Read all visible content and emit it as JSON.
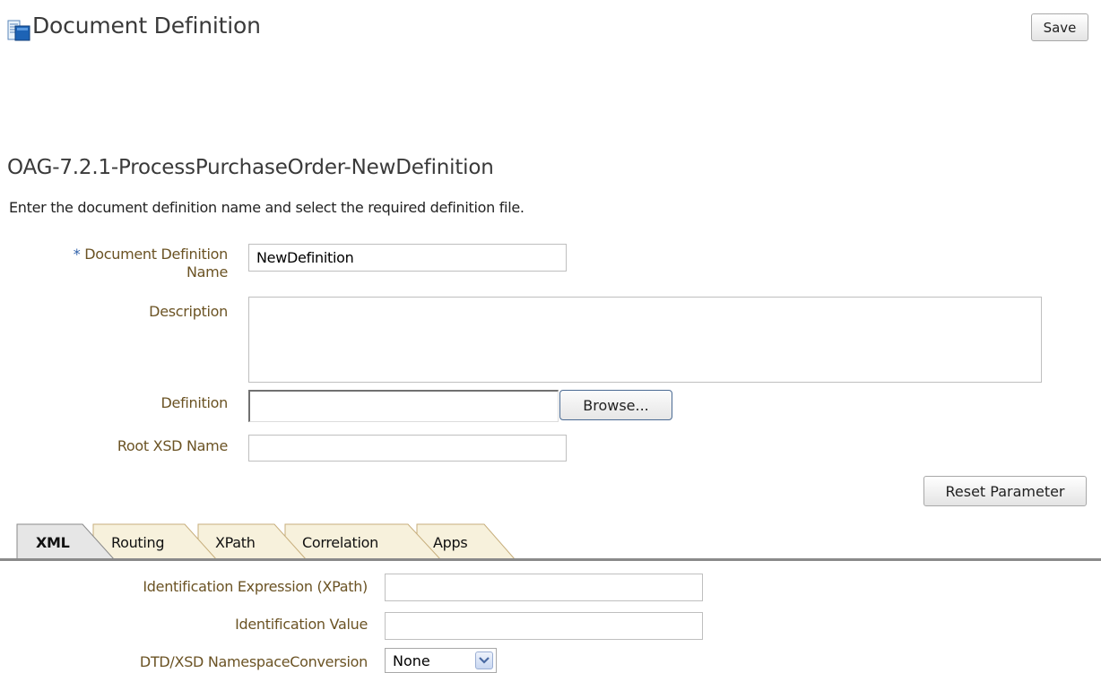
{
  "header": {
    "title": "Document Definition",
    "save_label": "Save"
  },
  "section": {
    "title": "OAG-7.2.1-ProcessPurchaseOrder-NewDefinition",
    "instruction": "Enter the document definition name and select the required definition file."
  },
  "form": {
    "required_marker": "*",
    "name_label_line1": "Document Definition",
    "name_label_line2": "Name",
    "name_value": "NewDefinition",
    "description_label": "Description",
    "description_value": "",
    "definition_label": "Definition",
    "definition_value": "",
    "browse_label": "Browse...",
    "root_xsd_label": "Root XSD Name",
    "root_xsd_value": "",
    "reset_label": "Reset Parameter"
  },
  "tabs": [
    {
      "label": "XML",
      "active": true
    },
    {
      "label": "Routing",
      "active": false
    },
    {
      "label": "XPath",
      "active": false
    },
    {
      "label": "Correlation",
      "active": false
    },
    {
      "label": "Apps",
      "active": false
    }
  ],
  "xml_tab": {
    "id_expr_label": "Identification Expression (XPath)",
    "id_expr_value": "",
    "id_value_label": "Identification Value",
    "id_value_value": "",
    "ns_conv_label": "DTD/XSD NamespaceConversion",
    "ns_conv_value": "None"
  },
  "colors": {
    "label_text": "#6b5324",
    "required_marker": "#2c5ea8",
    "tab_fill": "#f7f1dc",
    "tab_active_fill": "#e6e6e6",
    "tab_border": "#c7ae7c"
  },
  "icons": {
    "title_icon": "document-definition-icon",
    "select_arrow": "chevron-down-icon"
  }
}
